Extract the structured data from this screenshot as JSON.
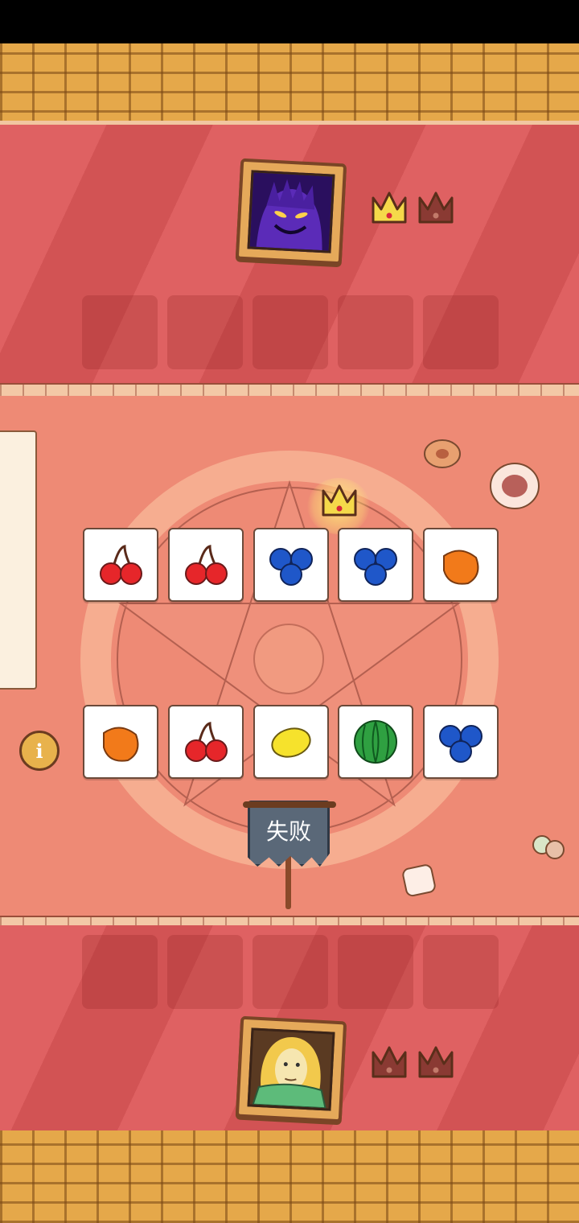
{
  "status": {
    "banner_text": "失败"
  },
  "opponent": {
    "avatar": "shadow-demon-portrait",
    "crowns": [
      {
        "state": "won",
        "color": "#f5d94a"
      },
      {
        "state": "empty",
        "color": "#8a3a33"
      }
    ]
  },
  "player": {
    "avatar": "blonde-hero-portrait",
    "crowns": [
      {
        "state": "empty",
        "color": "#8a3a33"
      },
      {
        "state": "empty",
        "color": "#8a3a33"
      }
    ]
  },
  "board": {
    "opponent_row": [
      "cherry",
      "cherry",
      "blueberry",
      "blueberry",
      "mango"
    ],
    "player_row": [
      "mango",
      "cherry",
      "lemon",
      "watermelon",
      "blueberry"
    ],
    "winner_crown_icon": "crown-icon"
  },
  "colors": {
    "cherry": "#e6262a",
    "blueberry": "#1f57c9",
    "mango": "#f27a1a",
    "lemon": "#f6e22c",
    "watermelon": "#2fa041",
    "curtain": "#dd5758",
    "board": "#ee8a75"
  },
  "icons": {
    "info": "info-icon"
  }
}
